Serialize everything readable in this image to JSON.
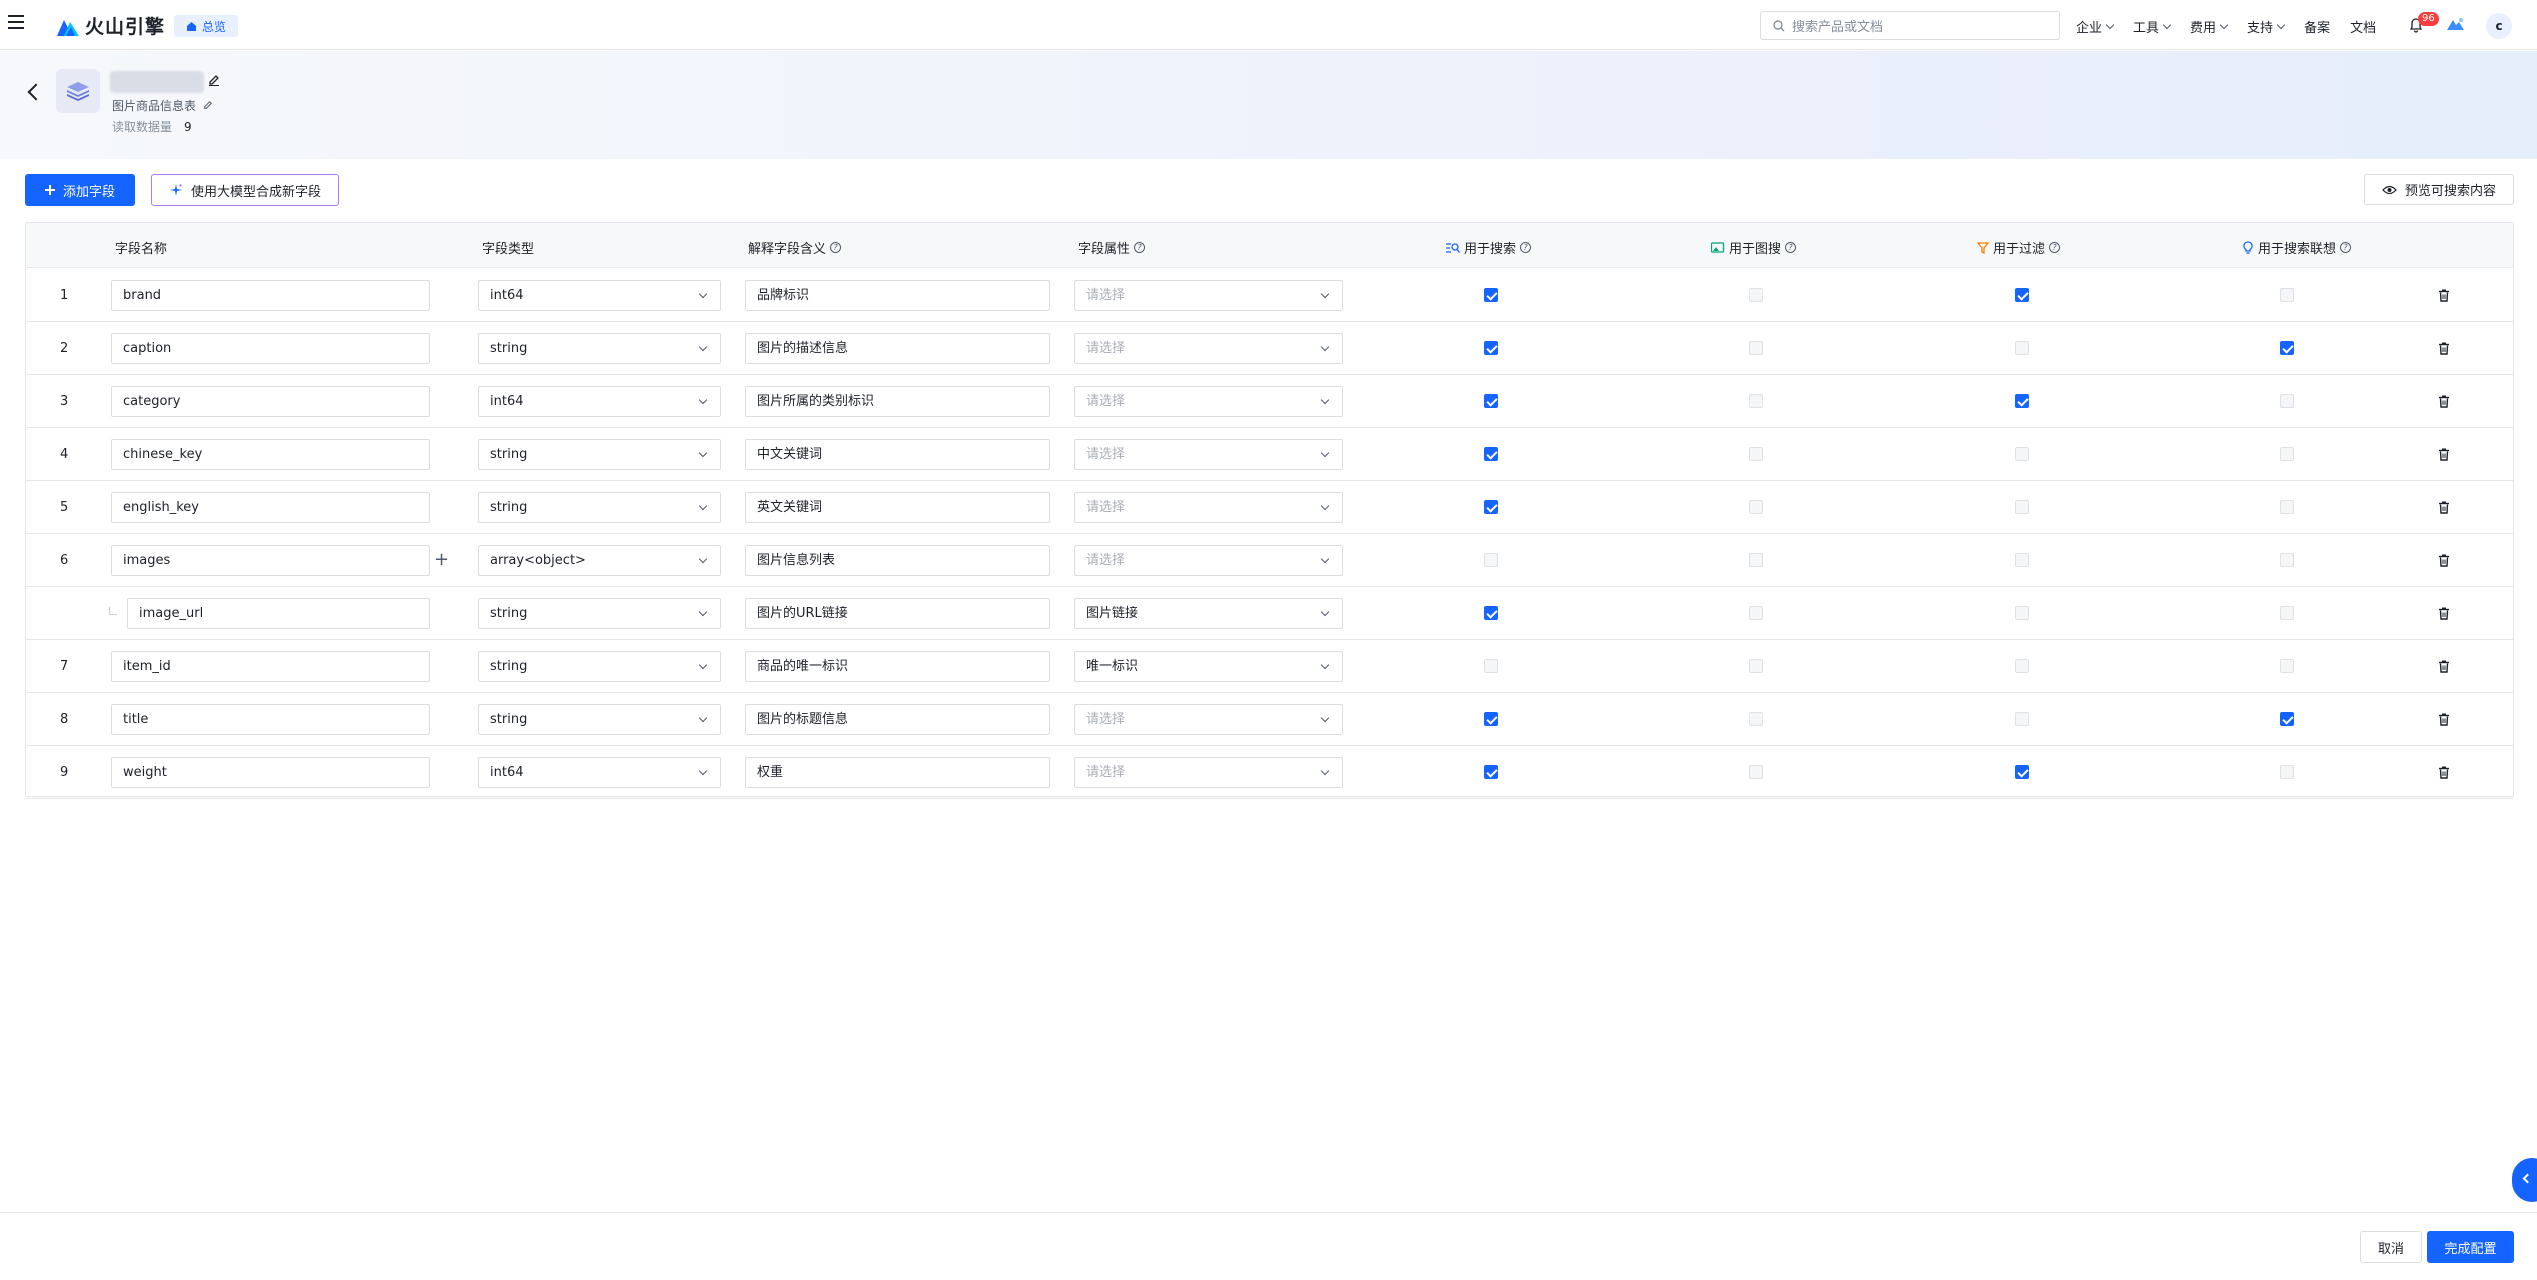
{
  "topnav": {
    "brand": "火山引擎",
    "home_chip": "总览",
    "search_placeholder": "搜索产品或文档",
    "menu": [
      {
        "label": "企业"
      },
      {
        "label": "工具"
      },
      {
        "label": "费用"
      },
      {
        "label": "支持"
      },
      {
        "label": "备案"
      },
      {
        "label": "文档"
      }
    ],
    "notification_count": "96",
    "avatar_letter": "c"
  },
  "header": {
    "sub_name": "图片商品信息表",
    "read_label": "读取数据量",
    "read_count": "9"
  },
  "actions": {
    "add_field": "添加字段",
    "ai_generate": "使用大模型合成新字段",
    "preview": "预览可搜索内容"
  },
  "table": {
    "headers": {
      "name": "字段名称",
      "type": "字段类型",
      "meaning": "解释字段含义",
      "attr": "字段属性",
      "search": "用于搜索",
      "image_search": "用于图搜",
      "filter": "用于过滤",
      "suggest": "用于搜索联想"
    },
    "rows": [
      {
        "num": "1",
        "name": "brand",
        "type": "int64",
        "meaning": "品牌标识",
        "attr": "请选择",
        "attr_placeholder": true,
        "search": true,
        "image_search": false,
        "filter": true,
        "suggest": false
      },
      {
        "num": "2",
        "name": "caption",
        "type": "string",
        "meaning": "图片的描述信息",
        "attr": "请选择",
        "attr_placeholder": true,
        "search": true,
        "image_search": false,
        "filter": false,
        "suggest": true
      },
      {
        "num": "3",
        "name": "category",
        "type": "int64",
        "meaning": "图片所属的类别标识",
        "attr": "请选择",
        "attr_placeholder": true,
        "search": true,
        "image_search": false,
        "filter": true,
        "suggest": false
      },
      {
        "num": "4",
        "name": "chinese_key",
        "type": "string",
        "meaning": "中文关键词",
        "attr": "请选择",
        "attr_placeholder": true,
        "search": true,
        "image_search": false,
        "filter": false,
        "suggest": false
      },
      {
        "num": "5",
        "name": "english_key",
        "type": "string",
        "meaning": "英文关键词",
        "attr": "请选择",
        "attr_placeholder": true,
        "search": true,
        "image_search": false,
        "filter": false,
        "suggest": false
      },
      {
        "num": "6",
        "name": "images",
        "type": "array<object>",
        "meaning": "图片信息列表",
        "attr": "请选择",
        "attr_placeholder": true,
        "search": false,
        "image_search": false,
        "filter": false,
        "suggest": false,
        "expandable": true
      },
      {
        "num": "",
        "name": "image_url",
        "type": "string",
        "meaning": "图片的URL链接",
        "attr": "图片链接",
        "attr_placeholder": false,
        "search": true,
        "image_search": false,
        "filter": false,
        "suggest": false,
        "child": true
      },
      {
        "num": "7",
        "name": "item_id",
        "type": "string",
        "meaning": "商品的唯一标识",
        "attr": "唯一标识",
        "attr_placeholder": false,
        "search": false,
        "image_search": false,
        "filter": false,
        "suggest": false
      },
      {
        "num": "8",
        "name": "title",
        "type": "string",
        "meaning": "图片的标题信息",
        "attr": "请选择",
        "attr_placeholder": true,
        "search": true,
        "image_search": false,
        "filter": false,
        "suggest": true
      },
      {
        "num": "9",
        "name": "weight",
        "type": "int64",
        "meaning": "权重",
        "attr": "请选择",
        "attr_placeholder": true,
        "search": true,
        "image_search": false,
        "filter": true,
        "suggest": false
      }
    ]
  },
  "footer": {
    "cancel": "取消",
    "done": "完成配置"
  },
  "colors": {
    "primary": "#1664ff",
    "badge": "#f53f3f",
    "ai_border": "#b07cf5"
  }
}
